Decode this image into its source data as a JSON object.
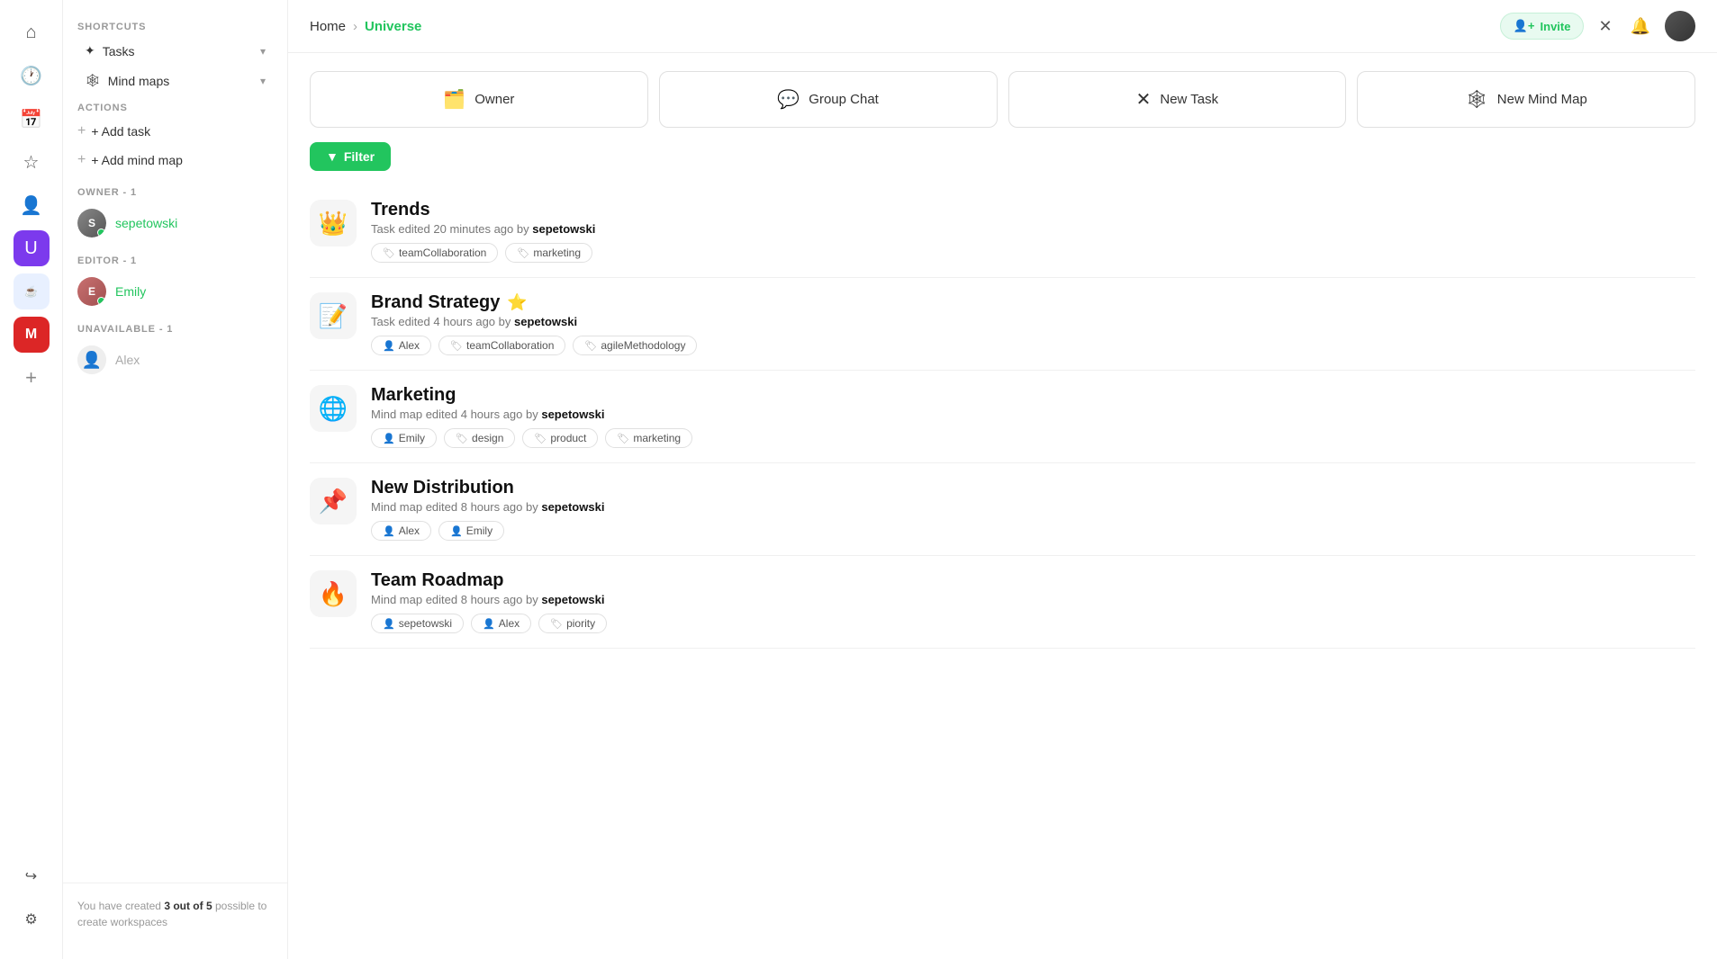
{
  "iconbar": {
    "items": [
      {
        "name": "home-icon",
        "icon": "⌂",
        "label": "Home"
      },
      {
        "name": "clock-icon",
        "icon": "🕐",
        "label": "Recent"
      },
      {
        "name": "calendar-icon",
        "icon": "📅",
        "label": "Calendar"
      },
      {
        "name": "star-icon",
        "icon": "☆",
        "label": "Favorites"
      },
      {
        "name": "person-icon",
        "icon": "👤",
        "label": "Profile"
      },
      {
        "name": "u-workspace",
        "icon": "U",
        "label": "U Workspace"
      },
      {
        "name": "java-workspace",
        "icon": "Java",
        "label": "Java"
      },
      {
        "name": "m-workspace",
        "icon": "M",
        "label": "M Workspace"
      },
      {
        "name": "add-workspace",
        "icon": "+",
        "label": "Add Workspace"
      }
    ],
    "bottom": [
      {
        "name": "logout-icon",
        "icon": "→|",
        "label": "Logout"
      },
      {
        "name": "settings-icon",
        "icon": "⚙",
        "label": "Settings"
      }
    ]
  },
  "sidebar": {
    "shortcuts_label": "SHORTCUTS",
    "tasks_label": "Tasks",
    "mindmaps_label": "Mind maps",
    "actions_label": "ACTIONS",
    "add_task_label": "+ Add task",
    "add_mindmap_label": "+ Add mind map",
    "owner_label": "OWNER - 1",
    "editor_label": "EDITOR - 1",
    "unavailable_label": "UNAVAILABLE - 1",
    "owner_user": "sepetowski",
    "editor_user": "Emily",
    "unavailable_user": "Alex",
    "footer_text": "You have created ",
    "footer_count": "3 out of 5",
    "footer_suffix": " possible to create workspaces"
  },
  "topbar": {
    "home_label": "Home",
    "current_label": "Universe",
    "invite_label": "Invite",
    "invite_icon": "👤+"
  },
  "actions": [
    {
      "name": "owner-button",
      "icon": "🗂️",
      "label": "Owner"
    },
    {
      "name": "group-chat-button",
      "icon": "💬",
      "label": "Group Chat"
    },
    {
      "name": "new-task-button",
      "icon": "✕",
      "label": "New Task"
    },
    {
      "name": "new-mind-map-button",
      "icon": "🕸",
      "label": "New Mind Map"
    }
  ],
  "filter": {
    "label": "Filter",
    "icon": "▼"
  },
  "items": [
    {
      "icon": "👑",
      "title": "Trends",
      "type": "task",
      "meta": "Task edited 20 minutes ago by ",
      "author": "sepetowski",
      "tags": [
        {
          "icon": "🏷",
          "label": "teamCollaboration"
        },
        {
          "icon": "🏷",
          "label": "marketing"
        }
      ],
      "star": false
    },
    {
      "icon": "📝",
      "title": "Brand Strategy",
      "type": "task",
      "meta": "Task edited 4 hours ago by ",
      "author": "sepetowski",
      "tags": [
        {
          "icon": "👤",
          "label": "Alex"
        },
        {
          "icon": "🏷",
          "label": "teamCollaboration"
        },
        {
          "icon": "🏷",
          "label": "agileMethodology"
        }
      ],
      "star": true
    },
    {
      "icon": "🌐",
      "title": "Marketing",
      "type": "mindmap",
      "meta": "Mind map edited 4 hours ago by ",
      "author": "sepetowski",
      "tags": [
        {
          "icon": "👤",
          "label": "Emily"
        },
        {
          "icon": "🏷",
          "label": "design"
        },
        {
          "icon": "🏷",
          "label": "product"
        },
        {
          "icon": "🏷",
          "label": "marketing"
        }
      ],
      "star": false
    },
    {
      "icon": "📌",
      "title": "New Distribution",
      "type": "mindmap",
      "meta": "Mind map edited 8 hours ago by ",
      "author": "sepetowski",
      "tags": [
        {
          "icon": "👤",
          "label": "Alex"
        },
        {
          "icon": "👤",
          "label": "Emily"
        }
      ],
      "star": false
    },
    {
      "icon": "🔥",
      "title": "Team Roadmap",
      "type": "mindmap",
      "meta": "Mind map edited 8 hours ago by ",
      "author": "sepetowski",
      "tags": [
        {
          "icon": "👤",
          "label": "sepetowski"
        },
        {
          "icon": "👤",
          "label": "Alex"
        },
        {
          "icon": "🏷",
          "label": "piority"
        }
      ],
      "star": false
    }
  ]
}
